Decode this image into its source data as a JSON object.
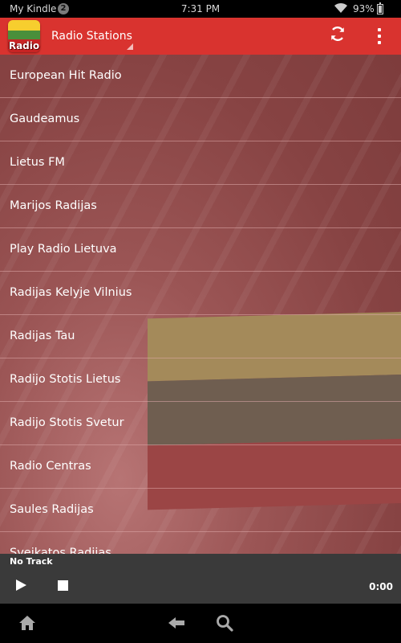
{
  "status_bar": {
    "carrier": "My Kindle",
    "notification_count": "2",
    "time": "7:31 PM",
    "battery_percent": "93%"
  },
  "action_bar": {
    "app_icon_label": "Radio",
    "title": "Radio Stations",
    "accent_color": "#d9332f"
  },
  "stations": [
    "European Hit Radio",
    "Gaudeamus",
    "Lietus FM",
    "Marijos Radijas",
    "Play Radio Lietuva",
    "Radijas Kelyje Vilnius",
    "Radijas Tau",
    "Radijo Stotis Lietus",
    "Radijo Stotis Svetur",
    "Radio Centras",
    "Saules Radijas",
    "Sveikatos Radijas"
  ],
  "player": {
    "track": "No Track",
    "elapsed": "0:00"
  }
}
